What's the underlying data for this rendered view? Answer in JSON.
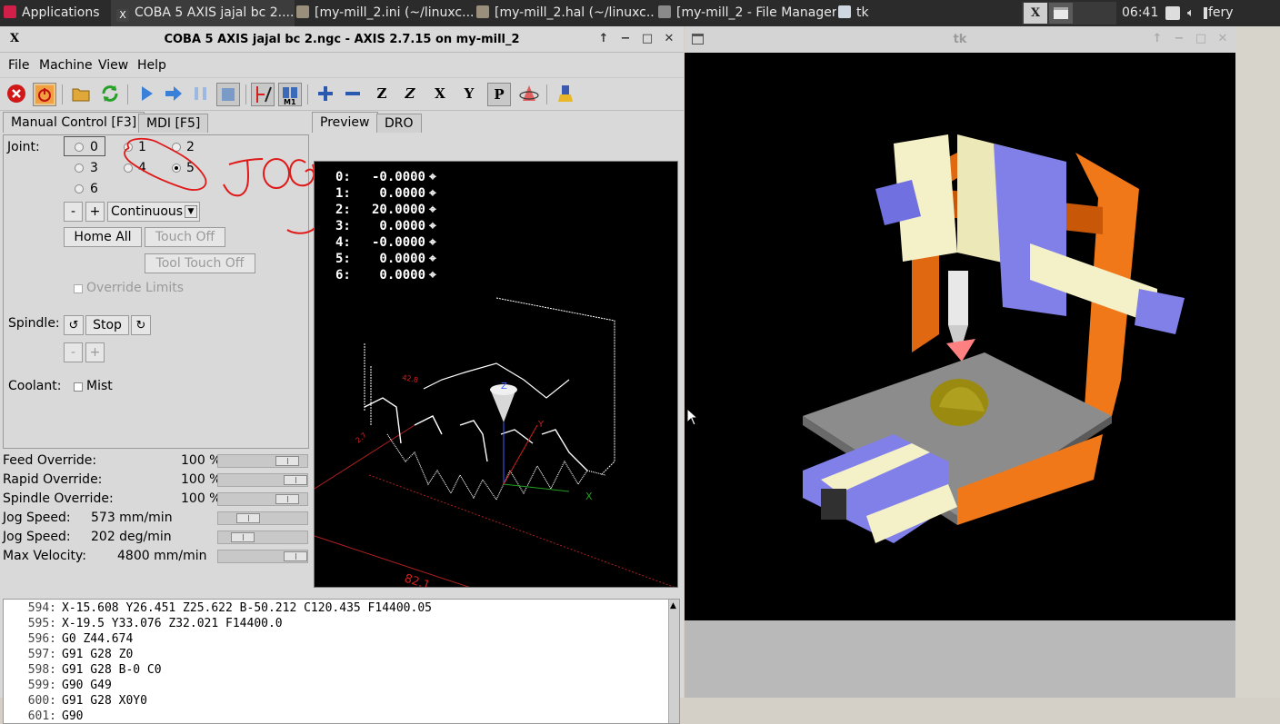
{
  "taskbar": {
    "apps_menu": "Applications",
    "tasks": [
      {
        "label": "COBA 5 AXIS jajal bc 2....",
        "active": true
      },
      {
        "label": "[my-mill_2.ini (~/linuxc...",
        "active": false
      },
      {
        "label": "[my-mill_2.hal (~/linuxc...",
        "active": false
      },
      {
        "label": "[my-mill_2 - File Manager]",
        "active": false
      },
      {
        "label": "tk",
        "active": false
      }
    ],
    "clock": "06:41",
    "user": "fery"
  },
  "axis": {
    "title": "COBA 5 AXIS jajal bc 2.ngc - AXIS 2.7.15 on my-mill_2",
    "menu": [
      "File",
      "Machine",
      "View",
      "Help"
    ],
    "toolbar": {
      "z_label": "Z",
      "z2_label": "Z",
      "x_label": "X",
      "y_label": "Y",
      "p_label": "P"
    },
    "tabs": {
      "manual": "Manual Control [F3]",
      "mdi": "MDI [F5]"
    },
    "manual": {
      "joint_label": "Joint:",
      "joints": [
        "0",
        "1",
        "2",
        "3",
        "4",
        "5",
        "6"
      ],
      "selected_joint": "5",
      "jog_minus": "-",
      "jog_plus": "+",
      "jog_mode": "Continuous",
      "home_all": "Home All",
      "touch_off": "Touch Off",
      "tool_touch_off": "Tool Touch Off",
      "override_limits": "Override Limits",
      "spindle_label": "Spindle:",
      "spindle_stop": "Stop",
      "spindle_minus": "-",
      "spindle_plus": "+",
      "coolant_label": "Coolant:",
      "mist": "Mist"
    },
    "overrides": [
      {
        "name": "Feed Override:",
        "value": "100 %",
        "level": 0.88
      },
      {
        "name": "Rapid Override:",
        "value": "100 %",
        "level": 1.0
      },
      {
        "name": "Spindle Override:",
        "value": "100 %",
        "level": 0.88
      },
      {
        "name": "Jog Speed:",
        "value": "573 mm/min",
        "level": 0.28
      },
      {
        "name": "Jog Speed:",
        "value": "202 deg/min",
        "level": 0.2
      },
      {
        "name": "Max Velocity:",
        "value": "4800 mm/min",
        "level": 1.0
      }
    ],
    "preview_tabs": {
      "preview": "Preview",
      "dro": "DRO"
    },
    "dro": [
      {
        "axis": "0:",
        "value": "-0.0000"
      },
      {
        "axis": "1:",
        "value": "0.0000"
      },
      {
        "axis": "2:",
        "value": "20.0000"
      },
      {
        "axis": "3:",
        "value": "0.0000"
      },
      {
        "axis": "4:",
        "value": "-0.0000"
      },
      {
        "axis": "5:",
        "value": "0.0000"
      },
      {
        "axis": "6:",
        "value": "0.0000"
      }
    ],
    "preview_labels": {
      "dim1": "82.1",
      "dim2": "42.8",
      "dim3": "2.7",
      "axis_x": "X",
      "axis_y": "Y",
      "axis_z": "Z"
    },
    "annotation": "JOG",
    "gcode": [
      {
        "n": "594:",
        "code": "X-15.608 Y26.451 Z25.622 B-50.212 C120.435 F14400.05"
      },
      {
        "n": "595:",
        "code": "X-19.5 Y33.076 Z32.021 F14400.0"
      },
      {
        "n": "596:",
        "code": "G0 Z44.674"
      },
      {
        "n": "597:",
        "code": "G91 G28 Z0"
      },
      {
        "n": "598:",
        "code": "G91 G28 B-0 C0"
      },
      {
        "n": "599:",
        "code": "G90 G49"
      },
      {
        "n": "600:",
        "code": "G91 G28 X0Y0"
      },
      {
        "n": "601:",
        "code": "G90"
      }
    ]
  },
  "tk": {
    "title": "tk"
  }
}
